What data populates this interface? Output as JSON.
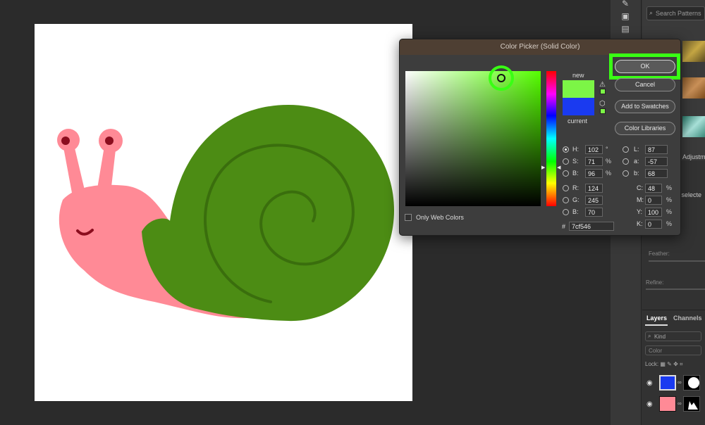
{
  "dialog": {
    "title": "Color Picker (Solid Color)",
    "new_label": "new",
    "current_label": "current",
    "new_color": "#7cf546",
    "current_color": "#1a3af0",
    "ok_label": "OK",
    "cancel_label": "Cancel",
    "add_swatches_label": "Add to Swatches",
    "color_libraries_label": "Color Libraries",
    "only_web_colors_label": "Only Web Colors",
    "only_web_colors_checked": false,
    "selected_mode": "H",
    "fields": {
      "H": "102",
      "S": "71",
      "B": "96",
      "R": "124",
      "G": "245",
      "B2": "70",
      "L": "87",
      "a": "-57",
      "b": "68",
      "C": "48",
      "M": "0",
      "Y": "100",
      "K": "0"
    },
    "labels": {
      "H": "H:",
      "S": "S:",
      "B": "B:",
      "R": "R:",
      "G": "G:",
      "B2": "B:",
      "L": "L:",
      "a": "a:",
      "b": "b:",
      "C": "C:",
      "M": "M:",
      "Y": "Y:",
      "K": "K:"
    },
    "units": {
      "degree": "°",
      "percent": "%"
    },
    "hex_symbol": "#",
    "hex": "7cf546",
    "highlight_color": "#39ff14"
  },
  "right_panel": {
    "search_placeholder": "Search Patterns",
    "adjustments_label": "Adjustm",
    "mask_label": "sk selecte",
    "feather_label": "Feather:",
    "refine_label": "Refine:"
  },
  "layers": {
    "tab_layers": "Layers",
    "tab_channels": "Channels",
    "kind_label": "Kind",
    "blend_mode": "Color",
    "lock_label": "Lock:",
    "rows": [
      {
        "fill": "#1a3af0"
      },
      {
        "fill": "#ff8a96"
      }
    ]
  },
  "artwork": {
    "shell_color": "#4c8c14",
    "body_color": "#ff8a96"
  }
}
